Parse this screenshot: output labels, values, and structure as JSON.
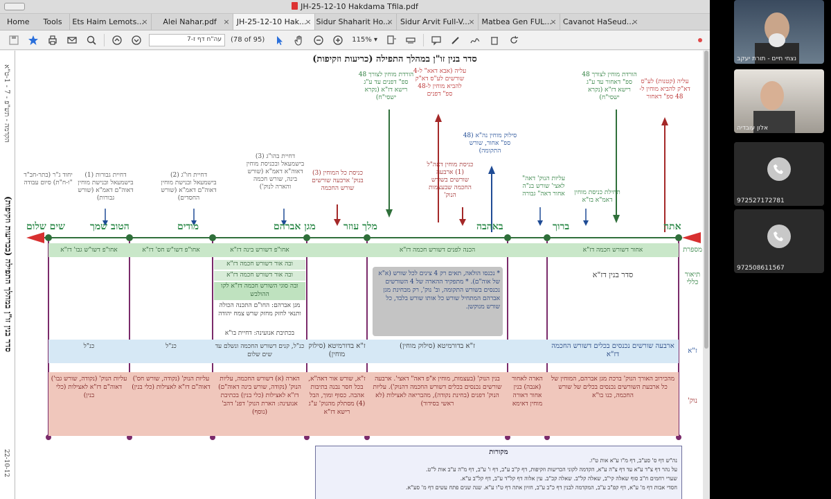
{
  "window": {
    "title": "JH-25-12-10 Hakdama Tfila.pdf"
  },
  "menu": [
    "Home",
    "Tools"
  ],
  "tabs": [
    {
      "label": "Ets Haim Lemots..."
    },
    {
      "label": "Alei Nahar.pdf"
    },
    {
      "label": "JH-25-12-10 Hak...",
      "active": true
    },
    {
      "label": "Sidur Shaharit Ho..."
    },
    {
      "label": "Sidur Arvit Full-V..."
    },
    {
      "label": "Matbea Gen FUL..."
    },
    {
      "label": "Cavanot HaSeud..."
    }
  ],
  "toolbar": {
    "page_field": "עה\"ח דף ז-7",
    "page_count": "(78 of 95)",
    "zoom": "115%"
  },
  "doc": {
    "left_vertical_title": "סדר בנין זו\"ן במהלך התפילה (בכריעות וזקיפות)",
    "left_vertical_sub": "הקדמה - תש\"פ - 7 - 1-ט\"א",
    "left_vertical_date": "22-10-12",
    "page_title": "סדר בנין זו\"ן במהלך התפילה",
    "page_title_paren": "(כריעות וזקיפות)",
    "top_notes": [
      "עליה (קטנות) לע\"ס דא\"ק להביא מוחין ל- 48 ספ\" דאחור",
      "הורדת מוחין לצורך 48 ספ\" דאחור עד ע\"ג רישא דז\"א (נקרא ישסי\"ח)",
      "עליה (אבא דאא\" ל-4 שורשים לע\"ס דא\"ק להביא מוחין ל-48 ספ\" דפנים",
      "הורדת מוחין לצורך 48 ספ\" דפנים עד ע\"ג רישא דז\"א (נקרא ישסי\"ח)"
    ],
    "mid_notes": [
      "סילוק מוחין נה\"א (48 ספ\" אחור, שורש התקומה)",
      "עליות הנוק' דאה\" לאצי' שורש בנ\"ה אחור דאה\" גבורה",
      "תחילת כניסת מוחין דאמ\"א בז\"א",
      "כניסת מוחין דאה\"ל (1) ארבעה שורשים בשורש החכמה שבעצמות הנוק'",
      "כניסת כל המוחין (3) בנוק' ארבעה שורשים שורש החכמה",
      "דחיית בהו\"ג (3) בישמעאל ובכניסת מוחין דאוה\"א דאמ\"א (שורש בינה, שורש חכמה והארה לנוק')",
      "דחיית חו\"ג (2) בישמעאל ובנישת מוחין דאוה\"ם דאמ\"א (שורש החסדים)",
      "דחיית גבורות (1) בישמעאל ובנישת מוחין דאוה\"ם דאמ\"א (שורש גבורות)",
      "יחוד ג\"ר (בתר-חב\"ד \"ו-ח\"ת) סיום עבודה"
    ],
    "words": [
      "אתה",
      "ברוך",
      "באהבה",
      "מלך עוזר",
      "מגן אברהם",
      "מודים",
      "הטוב שמך",
      "שים שלום"
    ],
    "row_labels": [
      "מספרת",
      "תיאור כללי",
      "ז\"א",
      "נוק'"
    ],
    "band1": [
      "אחור דשורש חכמה דז\"א",
      "הכנה לפנים דשורש חכמה דז\"א",
      "אחו\"פ דשורש בינה דז\"א",
      "אחו\"פ דשו\"ש חס' דז\"א",
      "אחו\"פ דשו\"ש גבו' דז\"א"
    ],
    "desc_main": "סדר בנין דז\"א",
    "desc_note": "* נכנסו הולאה, תאים רק 4 צינים לכל שורש (א\"א של אוה\"ם). * מתפקיד ההארה של 4 השורשים נכנסים בשורש התקומה, וב' נוק', רק מבחינת מגן אברהם המתחיל שורש כל אותו שורש בלבד, כל שורש מנוקשן.",
    "desc_inner": [
      "ובה אור דשורש חכמה דז\"א",
      "ובה אור דשורש חכמה דז\"א",
      "ובה סוגי השורש חכמה דז\"א לקו ההולבש",
      "מגן אברהם: החו\"ם התכנה הכולה ותנאי לחזק מחזק שרש צמח יהודה",
      "בכתיבת אנועינה: דחיית בו\"א"
    ],
    "za_row": [
      "ארבעה שורשים נכנסים בכלים דשורש החכמה דז\"א",
      "ז\"א בדורמיטא (סילוק מוחין)",
      "ז\"א בדורמיטא (סילוק מוחין)",
      "כנ\"ל, קנים דשורש החכמה ונשלם עד שים שלום",
      "כנ\"ל",
      "כנ\"ל"
    ],
    "nok_row": [
      "מהכירוב האורך הנוק' ברכת מגן אברהם, המוחין של כל ארבעת השורשים נכנסים בכלים של שורש החכמה, כנו בו\"א",
      "הארה לאחור (אנבה) בנין אחור דאורה מוחין דאימא",
      "בנין הנוק' (בעצמות, מוחין א\"פ דאה\" דאצי'. ארבעה שורשים נכנסים בכלים דשורש החכמה דהנוק'). עליות הנוק' דפנים (בחינת נקודה), מהבריאה לאצילות (לא ראשי בסידור)",
      "ז\"א, שורש אור דאה\"א, בכל חסר נבנה בתיבות אהבה. כסוף ומוך, הבל (4) מסתלק מהנוק' ע\"ג רישא דז\"א",
      "הארה (א) דשורש החכמה, עליות הנוק' (נקודה, שורש בינה דאוה\"ם) דז\"א לאצילות (כלי בנין) בכתיבת אנועינה: הארת הנוק' דפנ' דהב' (נוסף)",
      "עליות הנוק' (נקודה, שורש חס') דאוה\"ם דז\"א לאצילות (כלי בנין)",
      "עליות הנוק' (נקודה, שורש גבו') דאוה\"ם דז\"א לאצילות (כלי בנין)"
    ],
    "sources_head": "מקורות",
    "sources_lines": [
      "נה\"ש דף ס' סע\"ב, דף מ\"ו ע\"א אות ט\"ו.",
      "על נהר דף צ\"ד ע\"א עד דף צ\"ה ע\"א, הקדמה לקוני הכריעות וזקיפות, דף ק\"ב ע\"ב, דף ו' ע\"ב, דף מ\"ה ע\"ב אות ל\"ט.",
      "שערי רחמים ח\"ב סוף שאלה קי\"ב, שאלה קל\"ב. שאלה קכ\"ב. עין אלוה דף קל\"ד ע\"ב, דף קל\"ב ע\"א.",
      "חסדי אבות דף מ' ע\"א, דף קפ\"ב ע\"ב, המקדמה לבנין דף כ\"ב ע\"ב, חזיון אתה דף ט\"ו ע\"א. שנה שנים פתח עשים דף מ' סע\"א."
    ]
  },
  "participants": [
    {
      "name": "נצחי חיים - תורת יעקב"
    },
    {
      "name": "אלון עובדיה"
    },
    {
      "name": ""
    },
    {
      "name": "972527172781"
    },
    {
      "name": "972508611567"
    }
  ]
}
